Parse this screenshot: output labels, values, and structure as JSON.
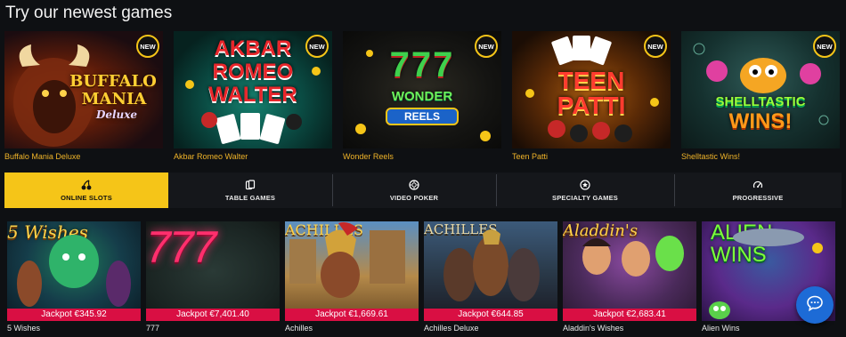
{
  "header": {
    "title": "Try our newest games"
  },
  "newest_games": [
    {
      "label": "Buffalo Mania Deluxe",
      "badge": "NEW",
      "art_text": [
        "BUFFALO",
        "MANIA",
        "Deluxe"
      ]
    },
    {
      "label": "Akbar Romeo Walter",
      "badge": "NEW",
      "art_text": [
        "AKBAR",
        "ROMEO",
        "WALTER"
      ]
    },
    {
      "label": "Wonder Reels",
      "badge": "NEW",
      "art_text": [
        "777",
        "WONDER",
        "REELS"
      ]
    },
    {
      "label": "Teen Patti",
      "badge": "NEW",
      "art_text": [
        "TEEN",
        "PATTI",
        ""
      ]
    },
    {
      "label": "Shelltastic Wins!",
      "badge": "NEW",
      "art_text": [
        "SHELLTASTIC",
        "WINS!",
        ""
      ]
    }
  ],
  "tabs": [
    {
      "label": "ONLINE SLOTS",
      "icon": "cherries-icon",
      "active": true
    },
    {
      "label": "TABLE GAMES",
      "icon": "cards-icon",
      "active": false
    },
    {
      "label": "VIDEO POKER",
      "icon": "poker-chip-icon",
      "active": false
    },
    {
      "label": "SPECIALTY GAMES",
      "icon": "star-icon",
      "active": false
    },
    {
      "label": "PROGRESSIVE",
      "icon": "gauge-icon",
      "active": false
    }
  ],
  "slot_games": [
    {
      "label": "5 Wishes",
      "jackpot": "Jackpot €345.92",
      "art_text": "5 Wishes"
    },
    {
      "label": "777",
      "jackpot": "Jackpot €7,401.40",
      "art_text": "777"
    },
    {
      "label": "Achilles",
      "jackpot": "Jackpot €1,669.61",
      "art_text": "ACHILLES"
    },
    {
      "label": "Achilles Deluxe",
      "jackpot": "Jackpot €644.85",
      "art_text": "ACHILLES"
    },
    {
      "label": "Aladdin's Wishes",
      "jackpot": "Jackpot €2,683.41",
      "art_text": "Aladdin's"
    },
    {
      "label": "Alien Wins",
      "jackpot": "",
      "art_text": "ALIEN WINS"
    }
  ],
  "colors": {
    "accent": "#f5c518",
    "jackpot": "#d90f43",
    "label_gold": "#f0b429",
    "chat": "#1d6bd6"
  },
  "chat": {
    "icon": "chat-bubble-icon"
  }
}
